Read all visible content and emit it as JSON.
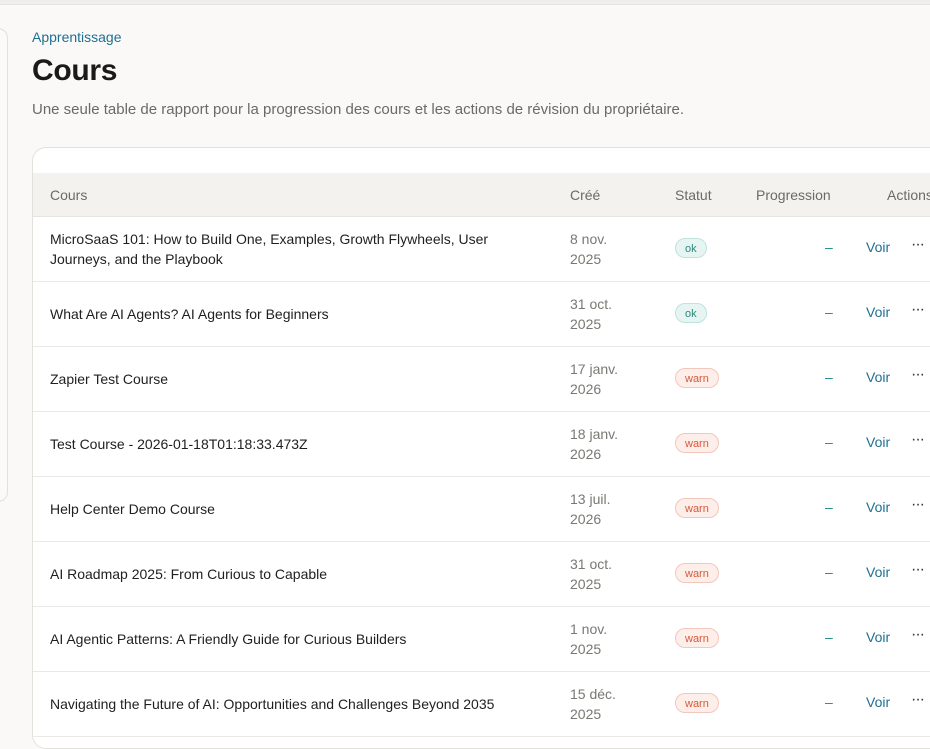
{
  "breadcrumb": "Apprentissage",
  "title": "Cours",
  "subtitle": "Une seule table de rapport pour la progression des cours et les actions de révision du propriétaire.",
  "table": {
    "headers": {
      "course": "Cours",
      "created": "Créé",
      "status": "Statut",
      "progress": "Progression",
      "actions": "Actions"
    },
    "rows": [
      {
        "title": "MicroSaaS 101: How to Build One, Examples, Growth Flywheels, User Journeys, and the Playbook",
        "date_line1": "8 nov.",
        "date_line2": "2025",
        "status": "ok",
        "progress": "–",
        "action": "Voir",
        "more": "···"
      },
      {
        "title": "What Are AI Agents? AI Agents for Beginners",
        "date_line1": "31 oct.",
        "date_line2": "2025",
        "status": "ok",
        "progress": "–",
        "action": "Voir",
        "more": "···"
      },
      {
        "title": "Zapier Test Course",
        "date_line1": "17 janv.",
        "date_line2": "2026",
        "status": "warn",
        "progress": "–",
        "action": "Voir",
        "more": "···"
      },
      {
        "title": "Test Course - 2026-01-18T01:18:33.473Z",
        "date_line1": "18 janv.",
        "date_line2": "2026",
        "status": "warn",
        "progress": "–",
        "action": "Voir",
        "more": "···"
      },
      {
        "title": "Help Center Demo Course",
        "date_line1": "13 juil.",
        "date_line2": "2026",
        "status": "warn",
        "progress": "–",
        "action": "Voir",
        "more": "···"
      },
      {
        "title": "AI Roadmap 2025: From Curious to Capable",
        "date_line1": "31 oct.",
        "date_line2": "2025",
        "status": "warn",
        "progress": "–",
        "action": "Voir",
        "more": "···"
      },
      {
        "title": "AI Agentic Patterns: A Friendly Guide for Curious Builders",
        "date_line1": "1 nov.",
        "date_line2": "2025",
        "status": "warn",
        "progress": "–",
        "action": "Voir",
        "more": "···"
      },
      {
        "title": "Navigating the Future of AI: Opportunities and Challenges Beyond 2035",
        "date_line1": "15 déc.",
        "date_line2": "2025",
        "status": "warn",
        "progress": "–",
        "action": "Voir",
        "more": "···"
      }
    ]
  },
  "colors": {
    "accent": "#1f6f93",
    "ok": "#2a8a7e",
    "warn": "#d65a3b"
  }
}
